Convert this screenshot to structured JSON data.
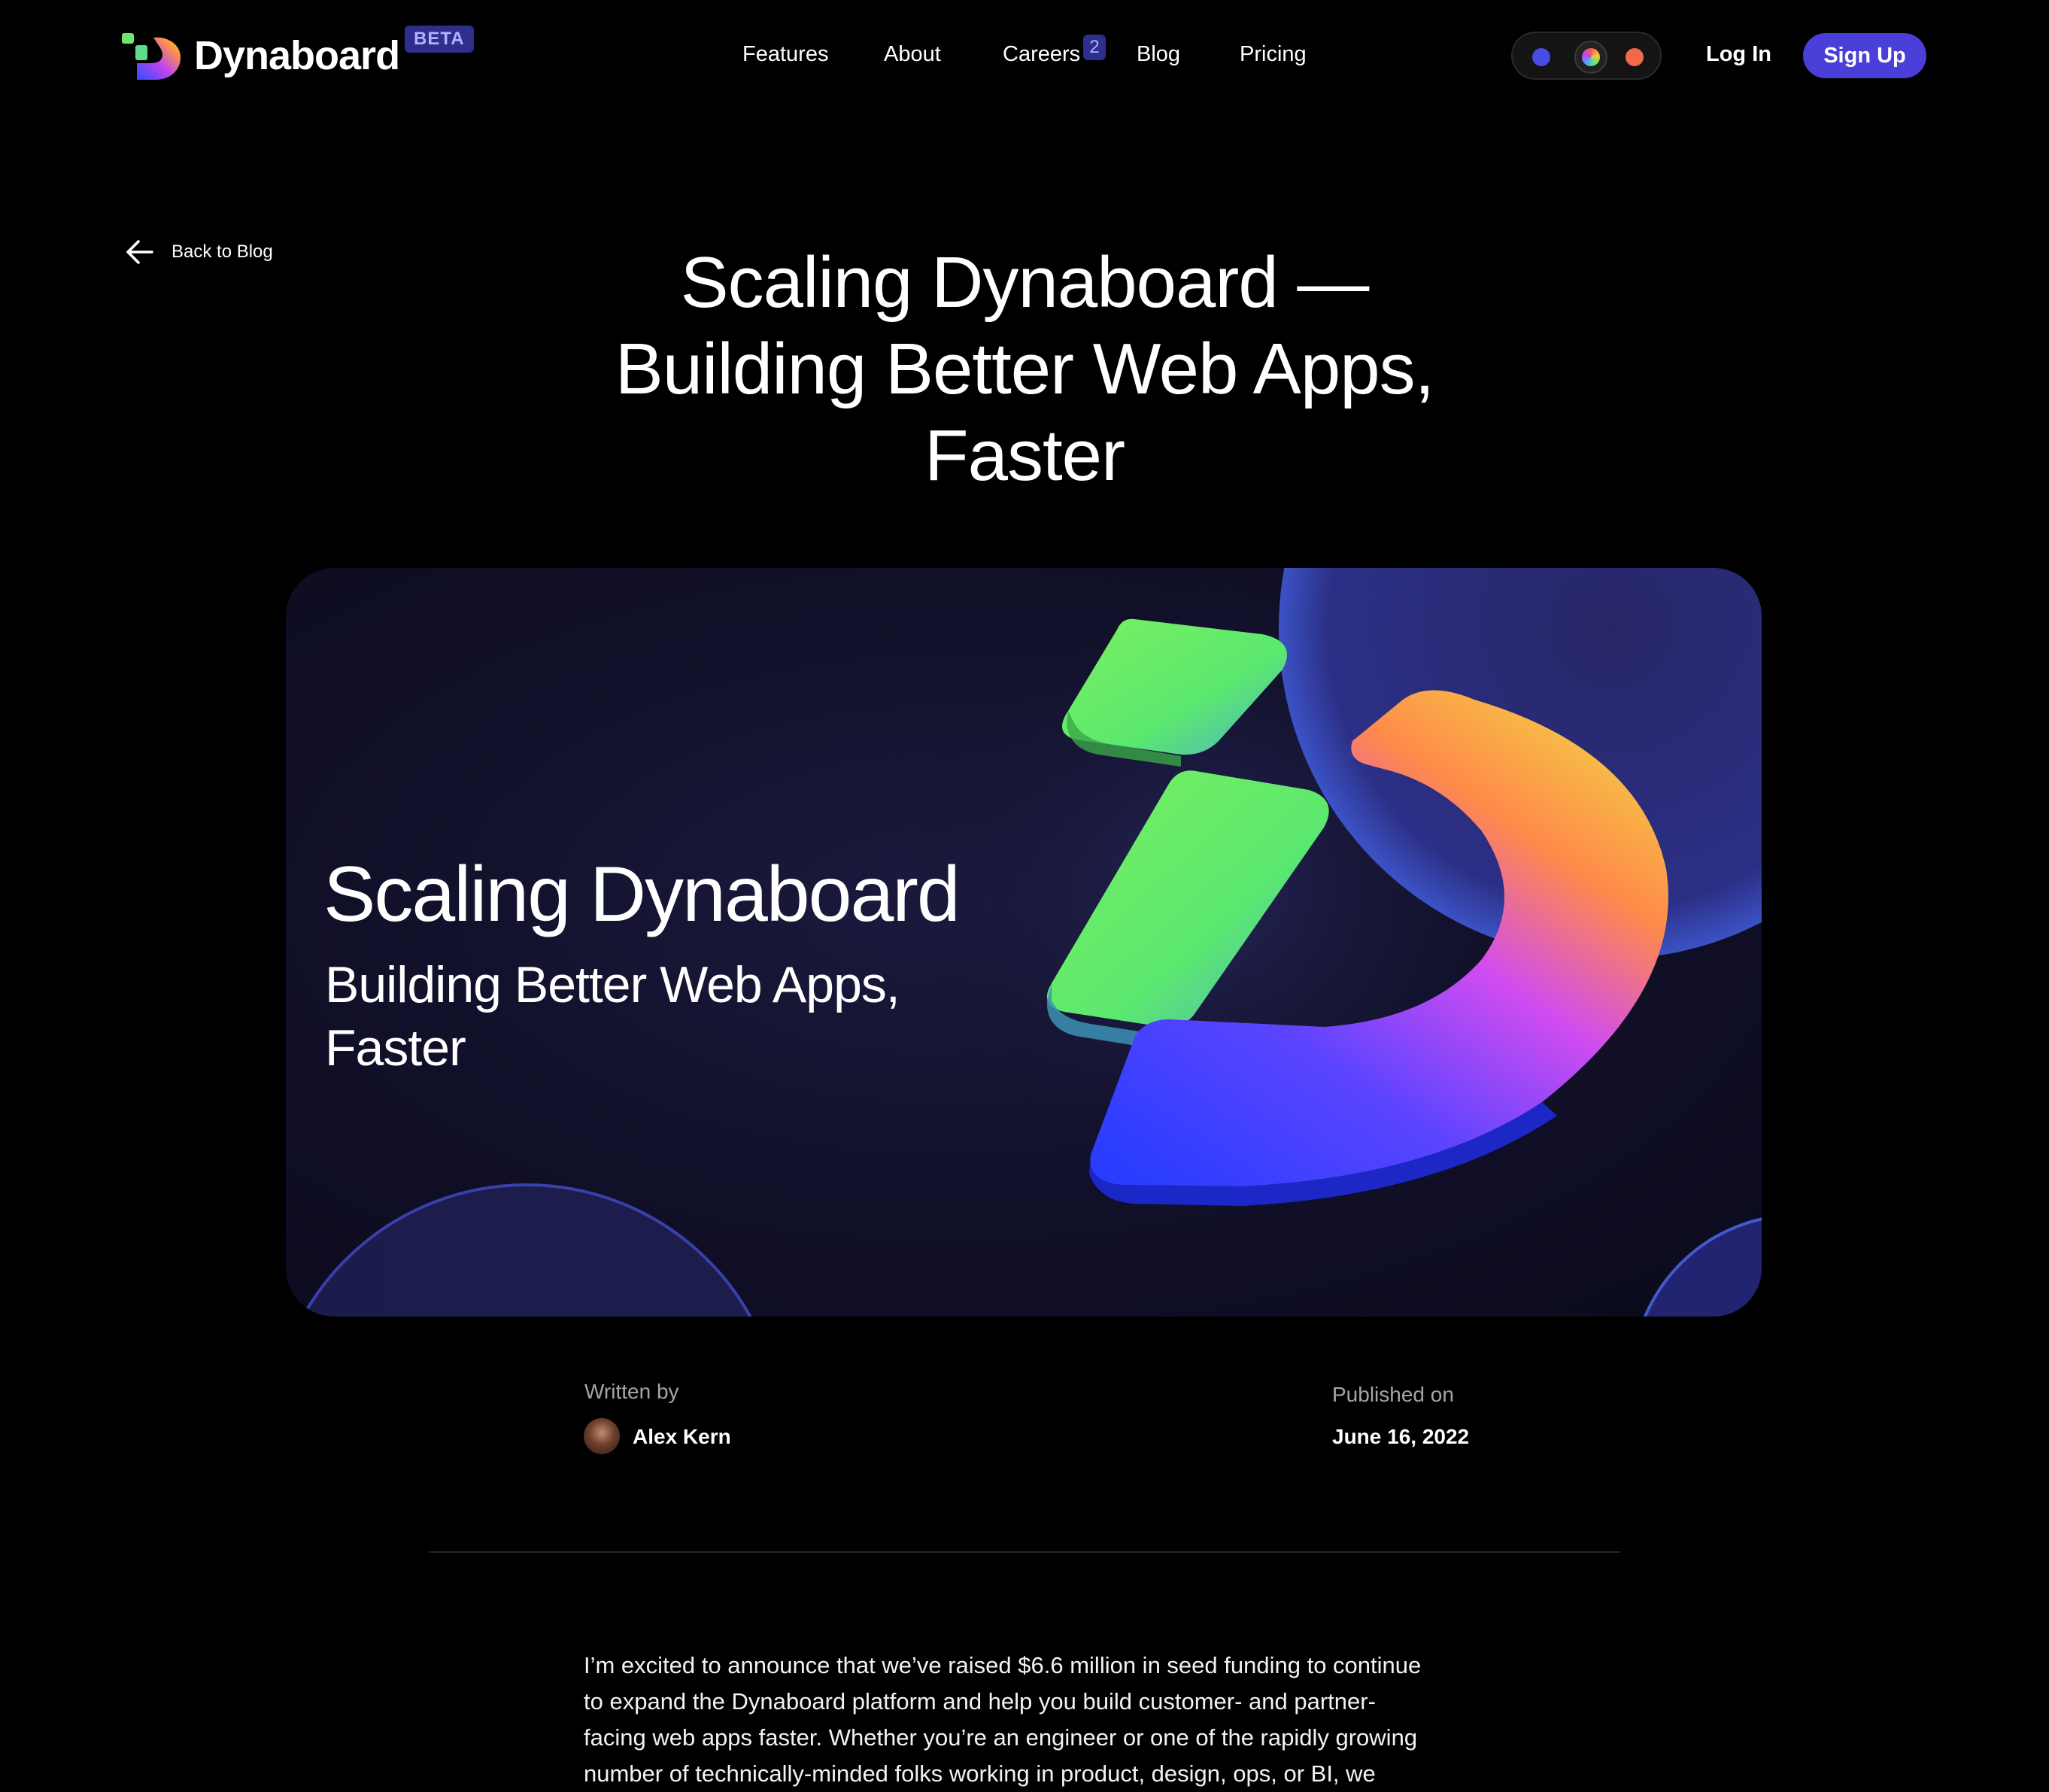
{
  "header": {
    "brand": "Dynaboard",
    "beta_label": "BETA",
    "nav": [
      {
        "label": "Features"
      },
      {
        "label": "About"
      },
      {
        "label": "Careers",
        "badge": "2"
      },
      {
        "label": "Blog"
      },
      {
        "label": "Pricing"
      }
    ],
    "theme_colors": [
      "#4a4ae6",
      "rainbow",
      "#f06a48"
    ],
    "login_label": "Log In",
    "signup_label": "Sign Up",
    "accent_color": "#4a3fd8"
  },
  "back_link": {
    "label": "Back to Blog",
    "icon": "arrow-left-icon"
  },
  "article": {
    "title_lines": [
      "Scaling Dynaboard —",
      "Building Better Web Apps,",
      "Faster"
    ],
    "hero": {
      "title": "Scaling Dynaboard",
      "subtitle_lines": [
        "Building Better Web Apps,",
        "Faster"
      ]
    },
    "written_by_label": "Written by",
    "author": "Alex Kern",
    "published_label": "Published on",
    "published_date": "June 16, 2022",
    "body_lines": [
      "I’m excited to announce that we’ve raised $6.6 million in seed funding to continue",
      "to expand the Dynaboard platform and help you build customer- and partner-",
      "facing web apps faster. Whether you’re an engineer or one of the rapidly growing",
      "number of technically-minded folks working in product, design, ops, or BI, we"
    ]
  }
}
